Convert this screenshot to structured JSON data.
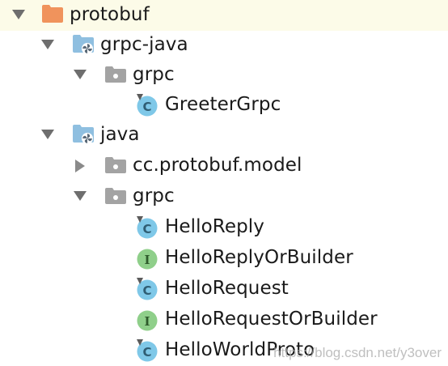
{
  "tree": {
    "items": [
      {
        "label": "protobuf",
        "kind": "module-folder",
        "expanded": true,
        "icon": "orange-folder-icon"
      },
      {
        "label": "grpc-java",
        "kind": "source-root",
        "expanded": true,
        "icon": "source-root-folder-icon"
      },
      {
        "label": "grpc",
        "kind": "package",
        "expanded": true,
        "icon": "package-icon"
      },
      {
        "label": "GreeterGrpc",
        "kind": "class",
        "icon": "class-icon"
      },
      {
        "label": "java",
        "kind": "source-root",
        "expanded": true,
        "icon": "source-root-folder-icon"
      },
      {
        "label": "cc.protobuf.model",
        "kind": "package",
        "expanded": false,
        "icon": "package-icon"
      },
      {
        "label": "grpc",
        "kind": "package",
        "expanded": true,
        "icon": "package-icon"
      },
      {
        "label": "HelloReply",
        "kind": "class",
        "icon": "class-icon"
      },
      {
        "label": "HelloReplyOrBuilder",
        "kind": "interface",
        "icon": "interface-icon"
      },
      {
        "label": "HelloRequest",
        "kind": "class",
        "icon": "class-icon"
      },
      {
        "label": "HelloRequestOrBuilder",
        "kind": "interface",
        "icon": "interface-icon"
      },
      {
        "label": "HelloWorldProto",
        "kind": "class",
        "icon": "class-icon"
      }
    ]
  },
  "glyphs": {
    "class_letter": "C",
    "interface_letter": "I"
  },
  "colors": {
    "class_badge": "#7fc8e8",
    "interface_badge": "#8fcf8a",
    "module_folder": "#f0935c",
    "source_root_folder": "#8fbfe0",
    "package_folder": "#a3a3a3",
    "row_highlight": "#fcfbe8"
  },
  "watermark": "https://blog.csdn.net/y3over"
}
